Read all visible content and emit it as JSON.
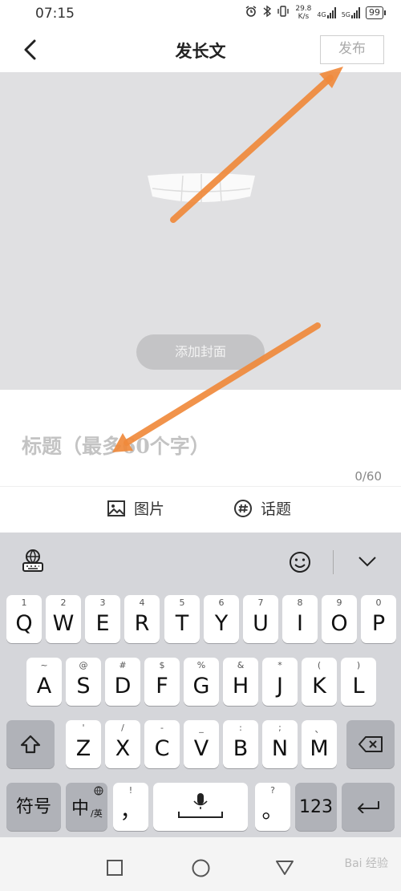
{
  "status": {
    "time": "07:15",
    "net_speed_top": "29.8",
    "net_speed_bottom": "K/s",
    "net1": "4G",
    "net2": "5G",
    "battery": "99"
  },
  "header": {
    "title": "发长文",
    "publish_label": "发布"
  },
  "cover": {
    "add_cover_label": "添加封面"
  },
  "editor": {
    "title_placeholder": "标题（最多60个字）",
    "char_count": "0/60"
  },
  "toolbar": {
    "image_label": "图片",
    "topic_label": "话题"
  },
  "keyboard": {
    "row1": [
      {
        "hint": "1",
        "key": "Q"
      },
      {
        "hint": "2",
        "key": "W"
      },
      {
        "hint": "3",
        "key": "E"
      },
      {
        "hint": "4",
        "key": "R"
      },
      {
        "hint": "5",
        "key": "T"
      },
      {
        "hint": "6",
        "key": "Y"
      },
      {
        "hint": "7",
        "key": "U"
      },
      {
        "hint": "8",
        "key": "I"
      },
      {
        "hint": "9",
        "key": "O"
      },
      {
        "hint": "0",
        "key": "P"
      }
    ],
    "row2": [
      {
        "hint": "~",
        "key": "A"
      },
      {
        "hint": "@",
        "key": "S"
      },
      {
        "hint": "#",
        "key": "D"
      },
      {
        "hint": "$",
        "key": "F"
      },
      {
        "hint": "%",
        "key": "G"
      },
      {
        "hint": "&",
        "key": "H"
      },
      {
        "hint": "*",
        "key": "J"
      },
      {
        "hint": "(",
        "key": "K"
      },
      {
        "hint": ")",
        "key": "L"
      }
    ],
    "row3": [
      {
        "hint": "'",
        "key": "Z"
      },
      {
        "hint": "/",
        "key": "X"
      },
      {
        "hint": "-",
        "key": "C"
      },
      {
        "hint": "_",
        "key": "V"
      },
      {
        "hint": ":",
        "key": "B"
      },
      {
        "hint": ";",
        "key": "N"
      },
      {
        "hint": "、",
        "key": "M"
      }
    ],
    "symbols_label": "符号",
    "lang_main": "中",
    "lang_sub": "/英",
    "comma": "，",
    "comma_hint": "!",
    "period": "。",
    "period_hint": "?",
    "num_label": "123"
  },
  "watermark": "Bai 经验"
}
